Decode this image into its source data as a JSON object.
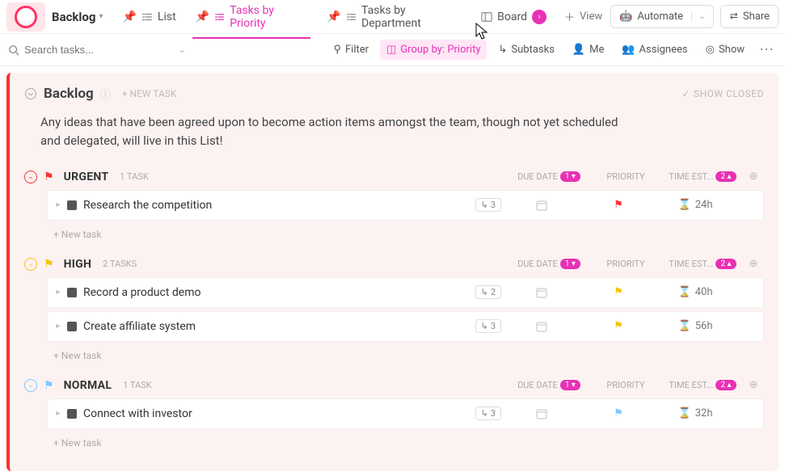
{
  "header": {
    "title": "Backlog",
    "tabs": [
      {
        "label": "List",
        "pinned": true
      },
      {
        "label": "Tasks by Priority",
        "pinned": true,
        "active": true
      },
      {
        "label": "Tasks by Department",
        "pinned": true
      },
      {
        "label": "Board",
        "pinned": false,
        "accent": true
      }
    ],
    "addView": "View",
    "automate": "Automate",
    "share": "Share"
  },
  "toolbar": {
    "searchPlaceholder": "Search tasks...",
    "filter": "Filter",
    "groupBy": "Group by: Priority",
    "subtasks": "Subtasks",
    "me": "Me",
    "assignees": "Assignees",
    "show": "Show"
  },
  "panel": {
    "title": "Backlog",
    "newTask": "+ NEW TASK",
    "showClosed": "SHOW CLOSED",
    "description": "Any ideas that have been agreed upon to become action items amongst the team, though not yet scheduled and delegated, will live in this List!"
  },
  "columns": {
    "dueDate": "DUE DATE",
    "dueBadge": "1",
    "priority": "PRIORITY",
    "timeEst": "TIME EST...",
    "timeBadge": "2"
  },
  "groups": [
    {
      "key": "urgent",
      "name": "URGENT",
      "count": "1 TASK",
      "color": "red",
      "tasks": [
        {
          "title": "Research the competition",
          "subtasks": "3",
          "priorityColor": "red",
          "time": "24h"
        }
      ]
    },
    {
      "key": "high",
      "name": "HIGH",
      "count": "2 TASKS",
      "color": "yellow",
      "tasks": [
        {
          "title": "Record a product demo",
          "subtasks": "2",
          "priorityColor": "yellow",
          "time": "40h"
        },
        {
          "title": "Create affiliate system",
          "subtasks": "3",
          "priorityColor": "yellow",
          "time": "56h"
        }
      ]
    },
    {
      "key": "normal",
      "name": "NORMAL",
      "count": "1 TASK",
      "color": "blue",
      "tasks": [
        {
          "title": "Connect with investor",
          "subtasks": "3",
          "priorityColor": "blue",
          "time": "32h"
        }
      ]
    }
  ],
  "newTaskLabel": "+ New task"
}
